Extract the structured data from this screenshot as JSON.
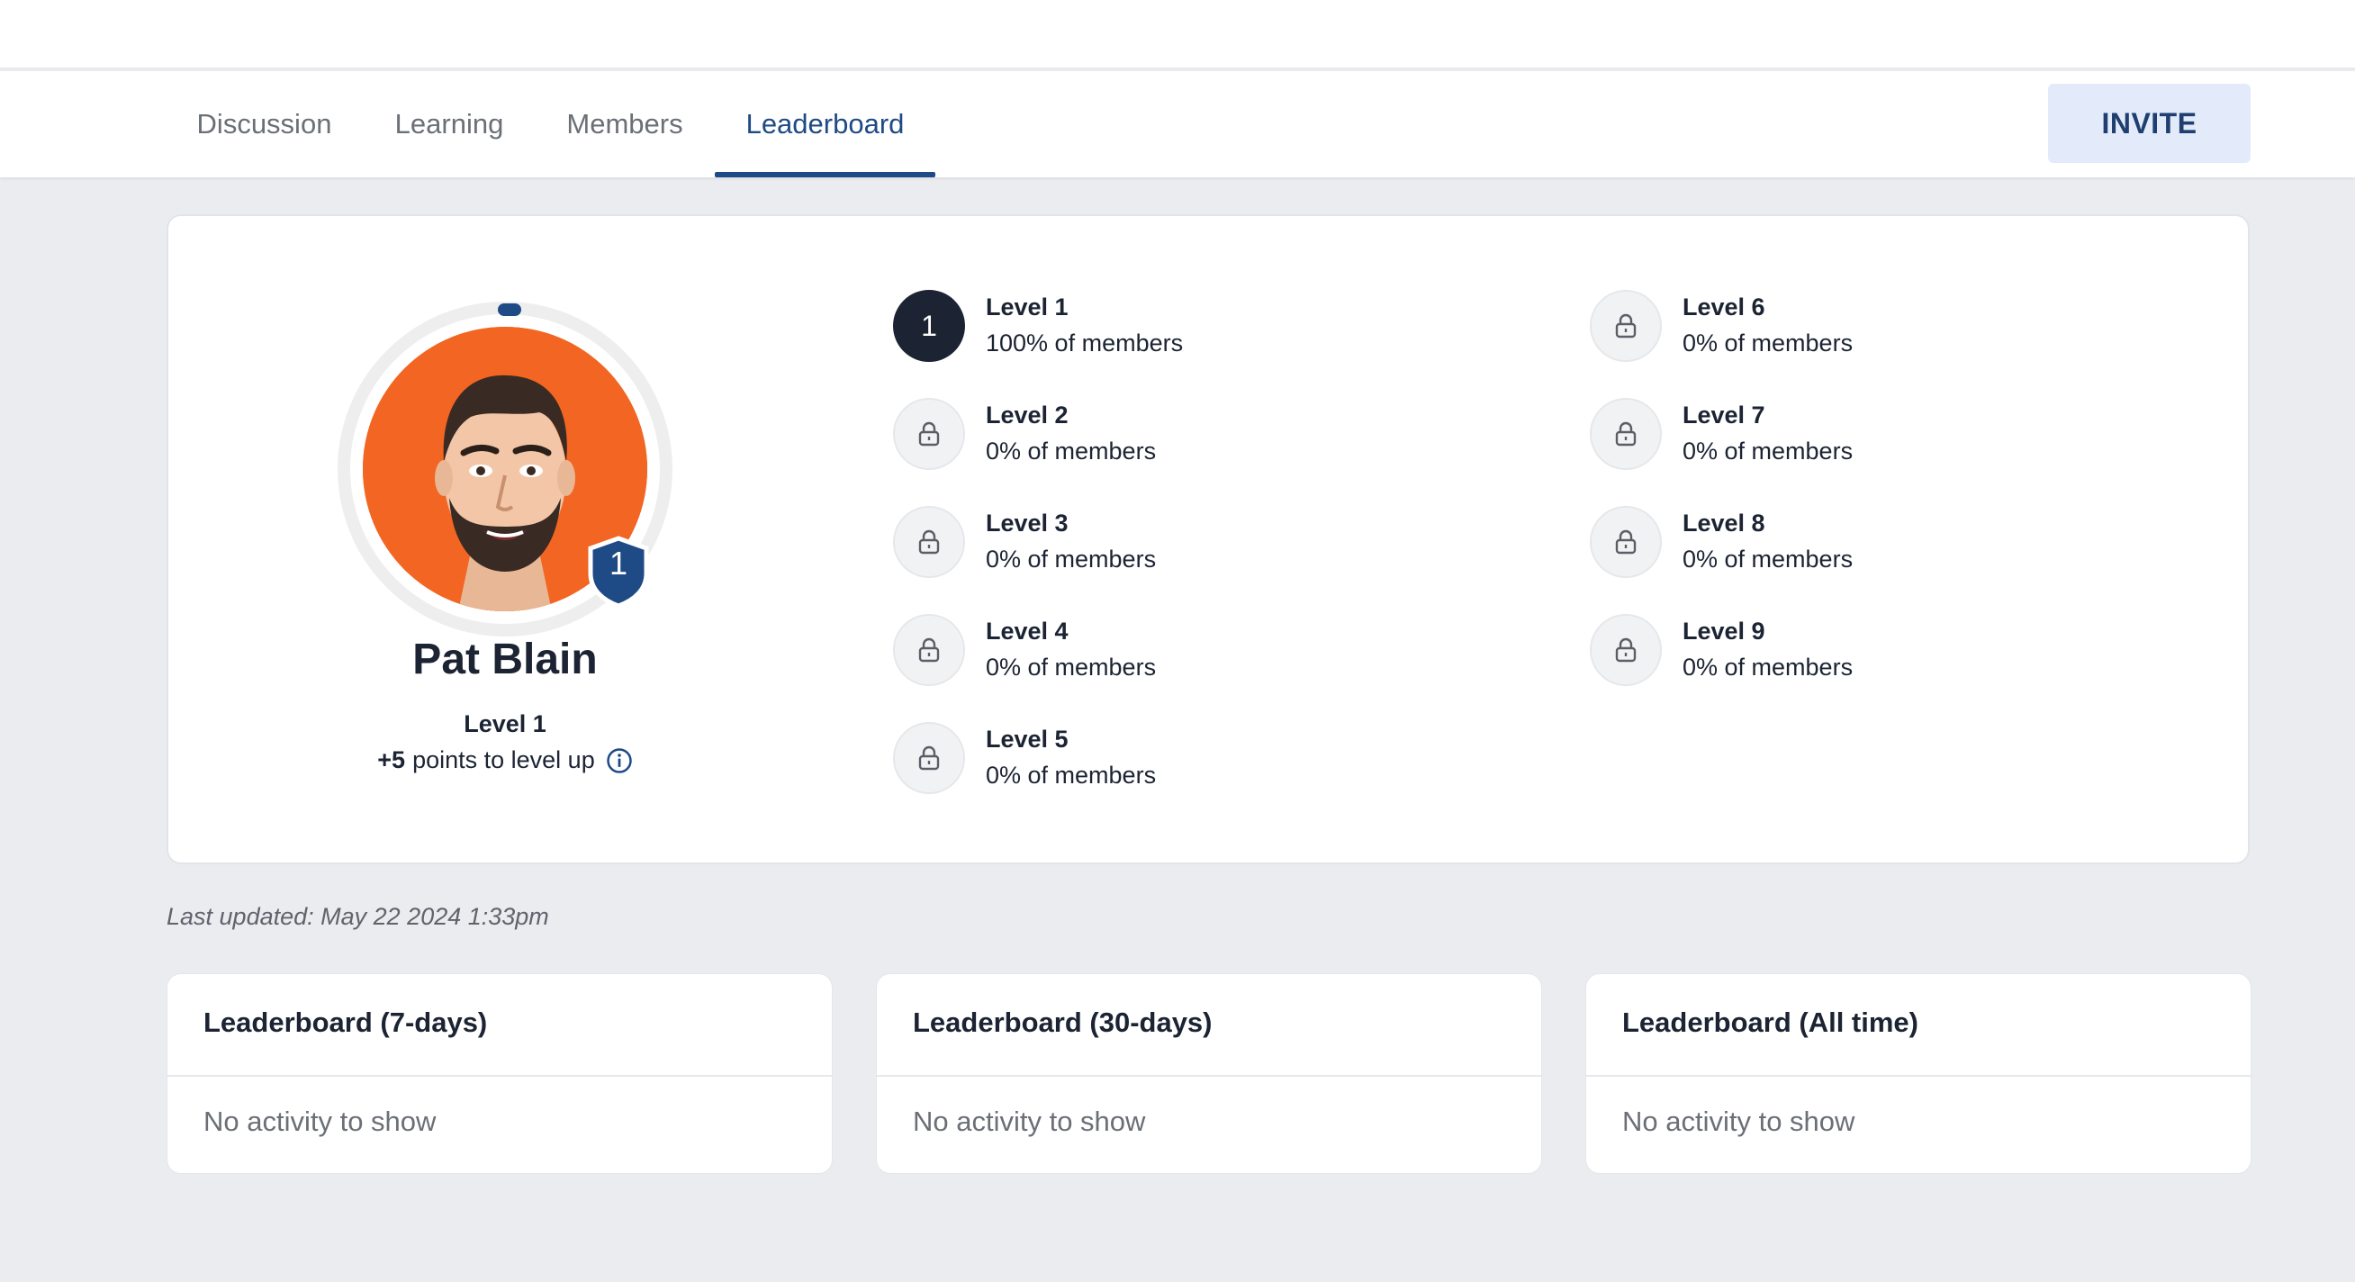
{
  "tabs": [
    {
      "label": "Discussion",
      "active": false
    },
    {
      "label": "Learning",
      "active": false
    },
    {
      "label": "Members",
      "active": false
    },
    {
      "label": "Leaderboard",
      "active": true
    }
  ],
  "invite_label": "INVITE",
  "profile": {
    "name": "Pat Blain",
    "level_label": "Level 1",
    "badge_number": "1",
    "points_bold": "+5",
    "points_rest": "points to level up",
    "avatar_bg": "#f26522",
    "level_progress": 0.02
  },
  "levels": [
    {
      "name": "Level 1",
      "pct": "100% of members",
      "unlocked": true,
      "num": "1"
    },
    {
      "name": "Level 2",
      "pct": "0% of members",
      "unlocked": false
    },
    {
      "name": "Level 3",
      "pct": "0% of members",
      "unlocked": false
    },
    {
      "name": "Level 4",
      "pct": "0% of members",
      "unlocked": false
    },
    {
      "name": "Level 5",
      "pct": "0% of members",
      "unlocked": false
    },
    {
      "name": "Level 6",
      "pct": "0% of members",
      "unlocked": false
    },
    {
      "name": "Level 7",
      "pct": "0% of members",
      "unlocked": false
    },
    {
      "name": "Level 8",
      "pct": "0% of members",
      "unlocked": false
    },
    {
      "name": "Level 9",
      "pct": "0% of members",
      "unlocked": false
    }
  ],
  "last_updated": "Last updated: May 22 2024 1:33pm",
  "leaderboards": [
    {
      "title": "Leaderboard (7-days)",
      "empty": "No activity to show"
    },
    {
      "title": "Leaderboard (30-days)",
      "empty": "No activity to show"
    },
    {
      "title": "Leaderboard (All time)",
      "empty": "No activity to show"
    }
  ],
  "colors": {
    "accent": "#1e4a85",
    "invite_bg": "#e3ebfa",
    "page_bg": "#ebecf0"
  }
}
